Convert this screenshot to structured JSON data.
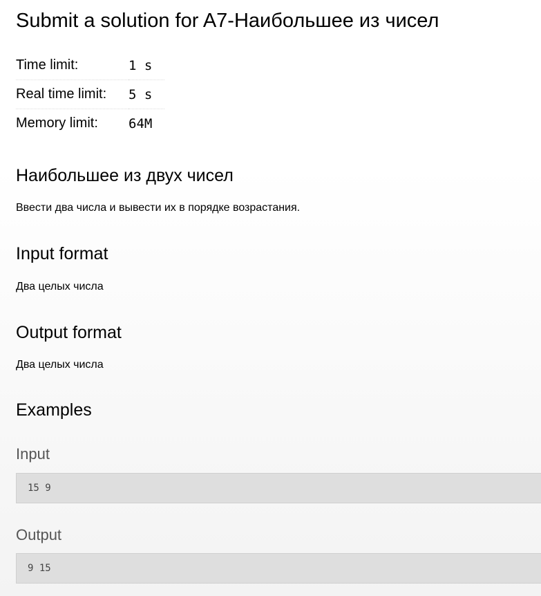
{
  "header": {
    "title": "Submit a solution for A7-Наибольшее из чисел"
  },
  "limits": [
    {
      "label": "Time limit:",
      "value": "1 s"
    },
    {
      "label": "Real time limit:",
      "value": "5 s"
    },
    {
      "label": "Memory limit:",
      "value": "64M"
    }
  ],
  "statement": {
    "title": "Наибольшее из двух чисел",
    "text": "Ввести два числа и вывести их в порядке возрастания."
  },
  "input_format": {
    "heading": "Input format",
    "text": "Два целых числа"
  },
  "output_format": {
    "heading": "Output format",
    "text": "Два целых числа"
  },
  "examples": {
    "heading": "Examples",
    "input_label": "Input",
    "input_value": "15 9",
    "output_label": "Output",
    "output_value": "9 15"
  }
}
